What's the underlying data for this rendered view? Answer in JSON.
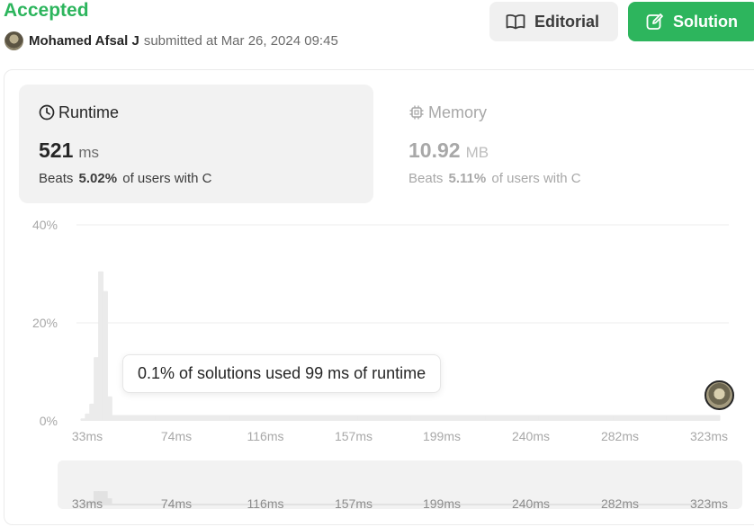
{
  "header": {
    "status": "Accepted",
    "submitter_name": "Mohamed Afsal J",
    "submitted_text": "submitted at Mar 26, 2024 09:45",
    "editorial_label": "Editorial",
    "solution_label": "Solution"
  },
  "runtime": {
    "label": "Runtime",
    "value": "521",
    "unit": "ms",
    "beats_prefix": "Beats",
    "beats_pct": "5.02%",
    "beats_suffix": "of users with C"
  },
  "memory": {
    "label": "Memory",
    "value": "10.92",
    "unit": "MB",
    "beats_prefix": "Beats",
    "beats_pct": "5.11%",
    "beats_suffix": "of users with C"
  },
  "tooltip": "0.1% of solutions used 99 ms of runtime",
  "colors": {
    "accepted": "#2db55d",
    "bar": "#ebebeb",
    "user_bar": "#262626"
  },
  "chart_data": {
    "type": "bar",
    "xlabel": "",
    "ylabel": "",
    "ylim": [
      0,
      40
    ],
    "y_ticks": [
      "40%",
      "20%",
      "0%"
    ],
    "x_ticks": [
      "33ms",
      "74ms",
      "116ms",
      "157ms",
      "199ms",
      "240ms",
      "282ms",
      "323ms"
    ],
    "values": [
      0.5,
      1.5,
      3.5,
      13,
      30.5,
      26.5,
      5,
      1.2,
      1.2,
      1.2,
      1.2,
      1.2,
      1.2,
      1.2,
      1.2,
      1.2,
      1.2,
      1.2,
      1.2,
      1.2,
      1.2,
      1.2,
      1.2,
      1.2,
      1.2,
      1.2,
      1.2,
      1.2,
      1.2,
      1.2,
      1.2,
      1.2,
      1.2,
      1.2,
      1.2,
      1.2,
      1.2,
      1.2,
      1.2,
      1.2,
      1.2,
      1.2,
      1.2,
      1.2,
      1.2,
      1.2,
      1.2,
      1.2,
      1.2,
      1.2,
      1.2,
      1.2,
      1.2,
      1.2,
      1.2,
      1.2,
      1.2,
      1.2,
      1.2,
      1.2,
      1.2,
      1.2,
      1.2,
      1.2,
      1.2,
      1.2,
      1.2,
      1.2,
      1.2,
      1.2,
      1.2,
      1.2,
      1.2,
      1.2,
      1.2,
      1.2,
      1.2,
      1.2,
      1.2,
      1.2,
      1.2,
      1.2,
      1.2,
      1.2,
      1.2,
      1.2,
      1.2,
      1.2,
      1.2,
      1.2,
      1.2,
      1.2,
      1.2,
      1.2,
      1.2,
      1.2,
      1.2,
      1.2,
      1.2,
      1.2,
      1.2,
      1.2,
      1.2,
      1.2,
      1.2,
      1.2,
      1.2,
      1.2,
      1.2,
      1.2,
      1.2,
      1.2,
      1.2,
      1.2,
      1.2,
      1.2,
      1.2,
      1.2,
      1.2,
      1.2,
      1.2,
      1.2,
      1.2,
      1.2,
      1.2,
      1.2,
      1.2,
      1.2,
      1.2,
      1.2,
      1.2,
      1.2,
      1.2,
      1.2,
      1.2,
      1.2,
      1.2,
      1.2,
      1.2,
      1.2,
      1.2,
      1.2,
      1.2,
      1.2,
      1.2
    ],
    "user_bar_index": 145,
    "grid": true
  }
}
